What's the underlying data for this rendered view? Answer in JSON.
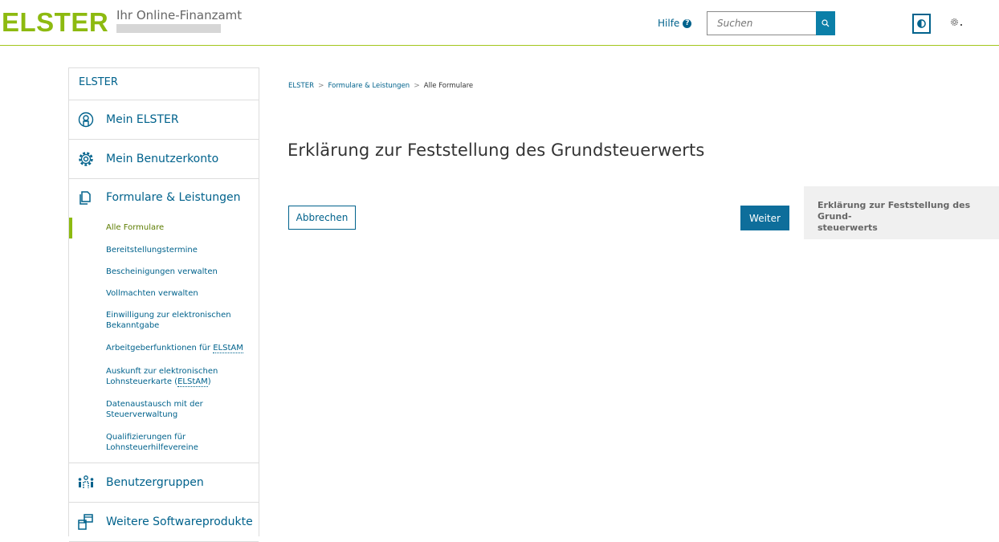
{
  "header": {
    "logo": "ELSTER",
    "tagline": "Ihr Online-Finanzamt",
    "help_label": "Hilfe",
    "help_icon_glyph": "?",
    "search_placeholder": "Suchen",
    "search_icon": "search-icon",
    "contrast_icon": "contrast-icon",
    "settings_icon": "gear-icon",
    "accent_color": "#8dba10"
  },
  "sidebar": {
    "head": "ELSTER",
    "items": [
      {
        "label": "Mein ELSTER",
        "icon": "user-circle-icon"
      },
      {
        "label": "Mein Benutzerkonto",
        "icon": "gear-icon"
      },
      {
        "label": "Formulare & Leistungen",
        "icon": "documents-icon"
      }
    ],
    "sub_items": [
      {
        "label": "Alle Formulare"
      },
      {
        "label": "Bereitstellungstermine"
      },
      {
        "label": "Bescheinigungen verwalten"
      },
      {
        "label": "Vollmachten verwalten"
      },
      {
        "line1": "Einwilligung zur elektronischen",
        "line2": "Bekanntgabe"
      },
      {
        "prefix": "Arbeitgeberfunktionen für ",
        "abbr": "ELStAM"
      },
      {
        "line1": "Auskunft zur elektronischen",
        "line2_prefix": "Lohnsteuerkarte (",
        "abbr": "ELStAM",
        "line2_suffix": ")"
      },
      {
        "line1": "Datenaustausch mit der",
        "line2": "Steuerverwaltung"
      },
      {
        "line1": "Qualifizierungen für",
        "line2": "Lohnsteuerhilfevereine"
      }
    ],
    "bottom_items": [
      {
        "label": "Benutzergruppen",
        "icon": "user-group-icon"
      },
      {
        "label": "Weitere Softwareprodukte",
        "icon": "software-products-icon"
      }
    ]
  },
  "breadcrumb": {
    "items": [
      "ELSTER",
      "Formulare & Leistungen",
      "Alle Formulare"
    ],
    "separator": ">"
  },
  "main": {
    "title": "Erklärung zur Feststellung des Grundsteuerwerts",
    "cancel_label": "Abbrechen",
    "next_label": "Weiter",
    "info_line1": "Erklärung zur Feststellung des Grund-",
    "info_line2": "steuerwerts"
  }
}
